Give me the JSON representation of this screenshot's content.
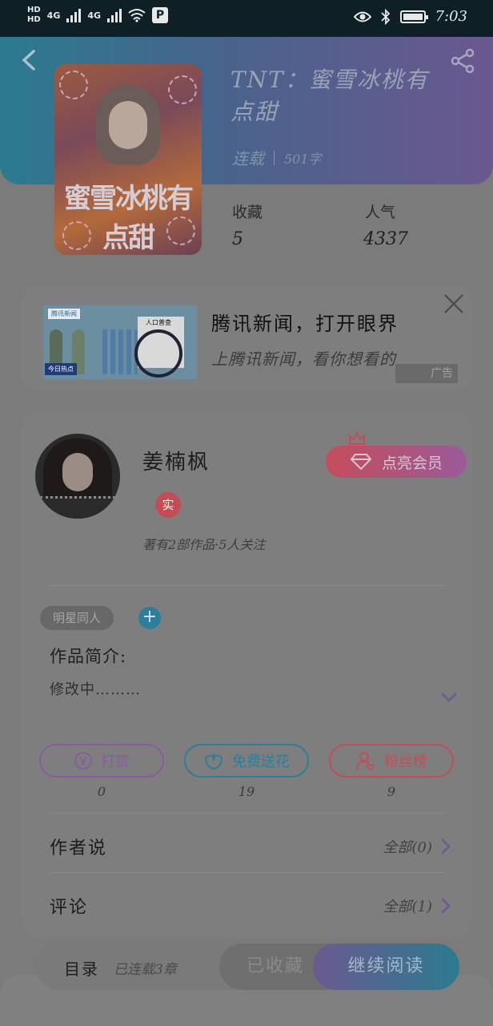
{
  "status_bar": {
    "hd1": "HD",
    "hd2": "HD",
    "net1": "4G",
    "net2": "4G",
    "p_icon": "P",
    "time": "7:03"
  },
  "book": {
    "title": "TNT：蜜雪冰桃有点甜",
    "cover_text": "蜜雪冰桃有点甜",
    "status": "连载",
    "word_count": "501字",
    "favorites_label": "收藏",
    "favorites_value": "5",
    "popularity_label": "人气",
    "popularity_value": "4337"
  },
  "ad": {
    "logo": "腾讯新闻",
    "tag": "今日热点",
    "doc_title": "人口普查",
    "title": "腾讯新闻，打开眼界",
    "desc": "上腾讯新闻，看你想看的",
    "badge": "广告"
  },
  "author": {
    "name": "姜楠枫",
    "real_badge": "实",
    "info": "著有2部作品·5人关注",
    "vip_button": "点亮会员"
  },
  "tags": {
    "items": [
      "明星同人"
    ],
    "add": "+"
  },
  "intro": {
    "label": "作品简介:",
    "text": "修改中………"
  },
  "actions": [
    {
      "label": "打赏",
      "count": "0",
      "color": "#8a5aa0"
    },
    {
      "label": "免费送花",
      "count": "19",
      "color": "#2c7e9a"
    },
    {
      "label": "粉丝榜",
      "count": "9",
      "color": "#c44d55"
    }
  ],
  "rows": {
    "author_says": {
      "title": "作者说",
      "right": "全部(0)"
    },
    "comments": {
      "title": "评论",
      "right": "全部(1)"
    }
  },
  "bottom": {
    "toc_label": "目录",
    "toc_sub": "已连载3章",
    "fav_button": "已收藏",
    "read_button": "继续阅读"
  },
  "colors": {
    "overlay_bg": "#7b7b7b",
    "accent_purple": "#6a5890",
    "accent_teal": "#2b7b8f",
    "accent_red": "#c44d55"
  }
}
